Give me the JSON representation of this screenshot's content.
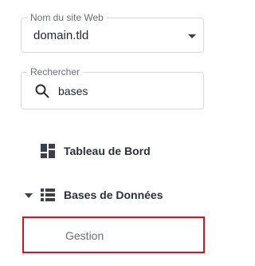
{
  "site_selector": {
    "label": "Nom du site Web",
    "value": "domain.tld"
  },
  "search": {
    "label": "Rechercher",
    "value": "bases"
  },
  "nav": {
    "dashboard": {
      "label": "Tableau de Bord",
      "icon": "dashboard-icon"
    },
    "databases": {
      "label": "Bases de Données",
      "icon": "database-list-icon",
      "expanded": true,
      "children": [
        {
          "label": "Gestion",
          "highlighted": true
        }
      ]
    }
  },
  "colors": {
    "highlight_border": "#d0171f",
    "border": "#d6d9e0",
    "text": "#1f2430",
    "muted_text": "#6a6e79"
  }
}
